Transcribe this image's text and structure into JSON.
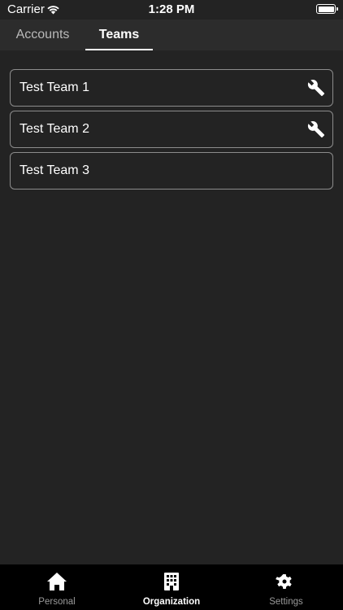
{
  "status_bar": {
    "carrier": "Carrier",
    "time": "1:28 PM",
    "wifi_icon": "wifi-icon",
    "battery_icon": "battery-icon"
  },
  "top_tabs": [
    {
      "label": "Accounts",
      "active": false
    },
    {
      "label": "Teams",
      "active": true
    }
  ],
  "teams": [
    {
      "name": "Test Team 1",
      "icon": "wrench-icon"
    },
    {
      "name": "Test Team 2",
      "icon": "wrench-icon"
    },
    {
      "name": "Test Team 3",
      "icon": ""
    }
  ],
  "bottom_tabs": [
    {
      "label": "Personal",
      "icon": "home-icon",
      "active": false
    },
    {
      "label": "Organization",
      "icon": "building-icon",
      "active": true
    },
    {
      "label": "Settings",
      "icon": "gear-icon",
      "active": false
    }
  ],
  "colors": {
    "background": "#232323",
    "tab_bar": "#2c2c2c",
    "border": "#8c8c8c",
    "bottom_bar": "#000000"
  }
}
